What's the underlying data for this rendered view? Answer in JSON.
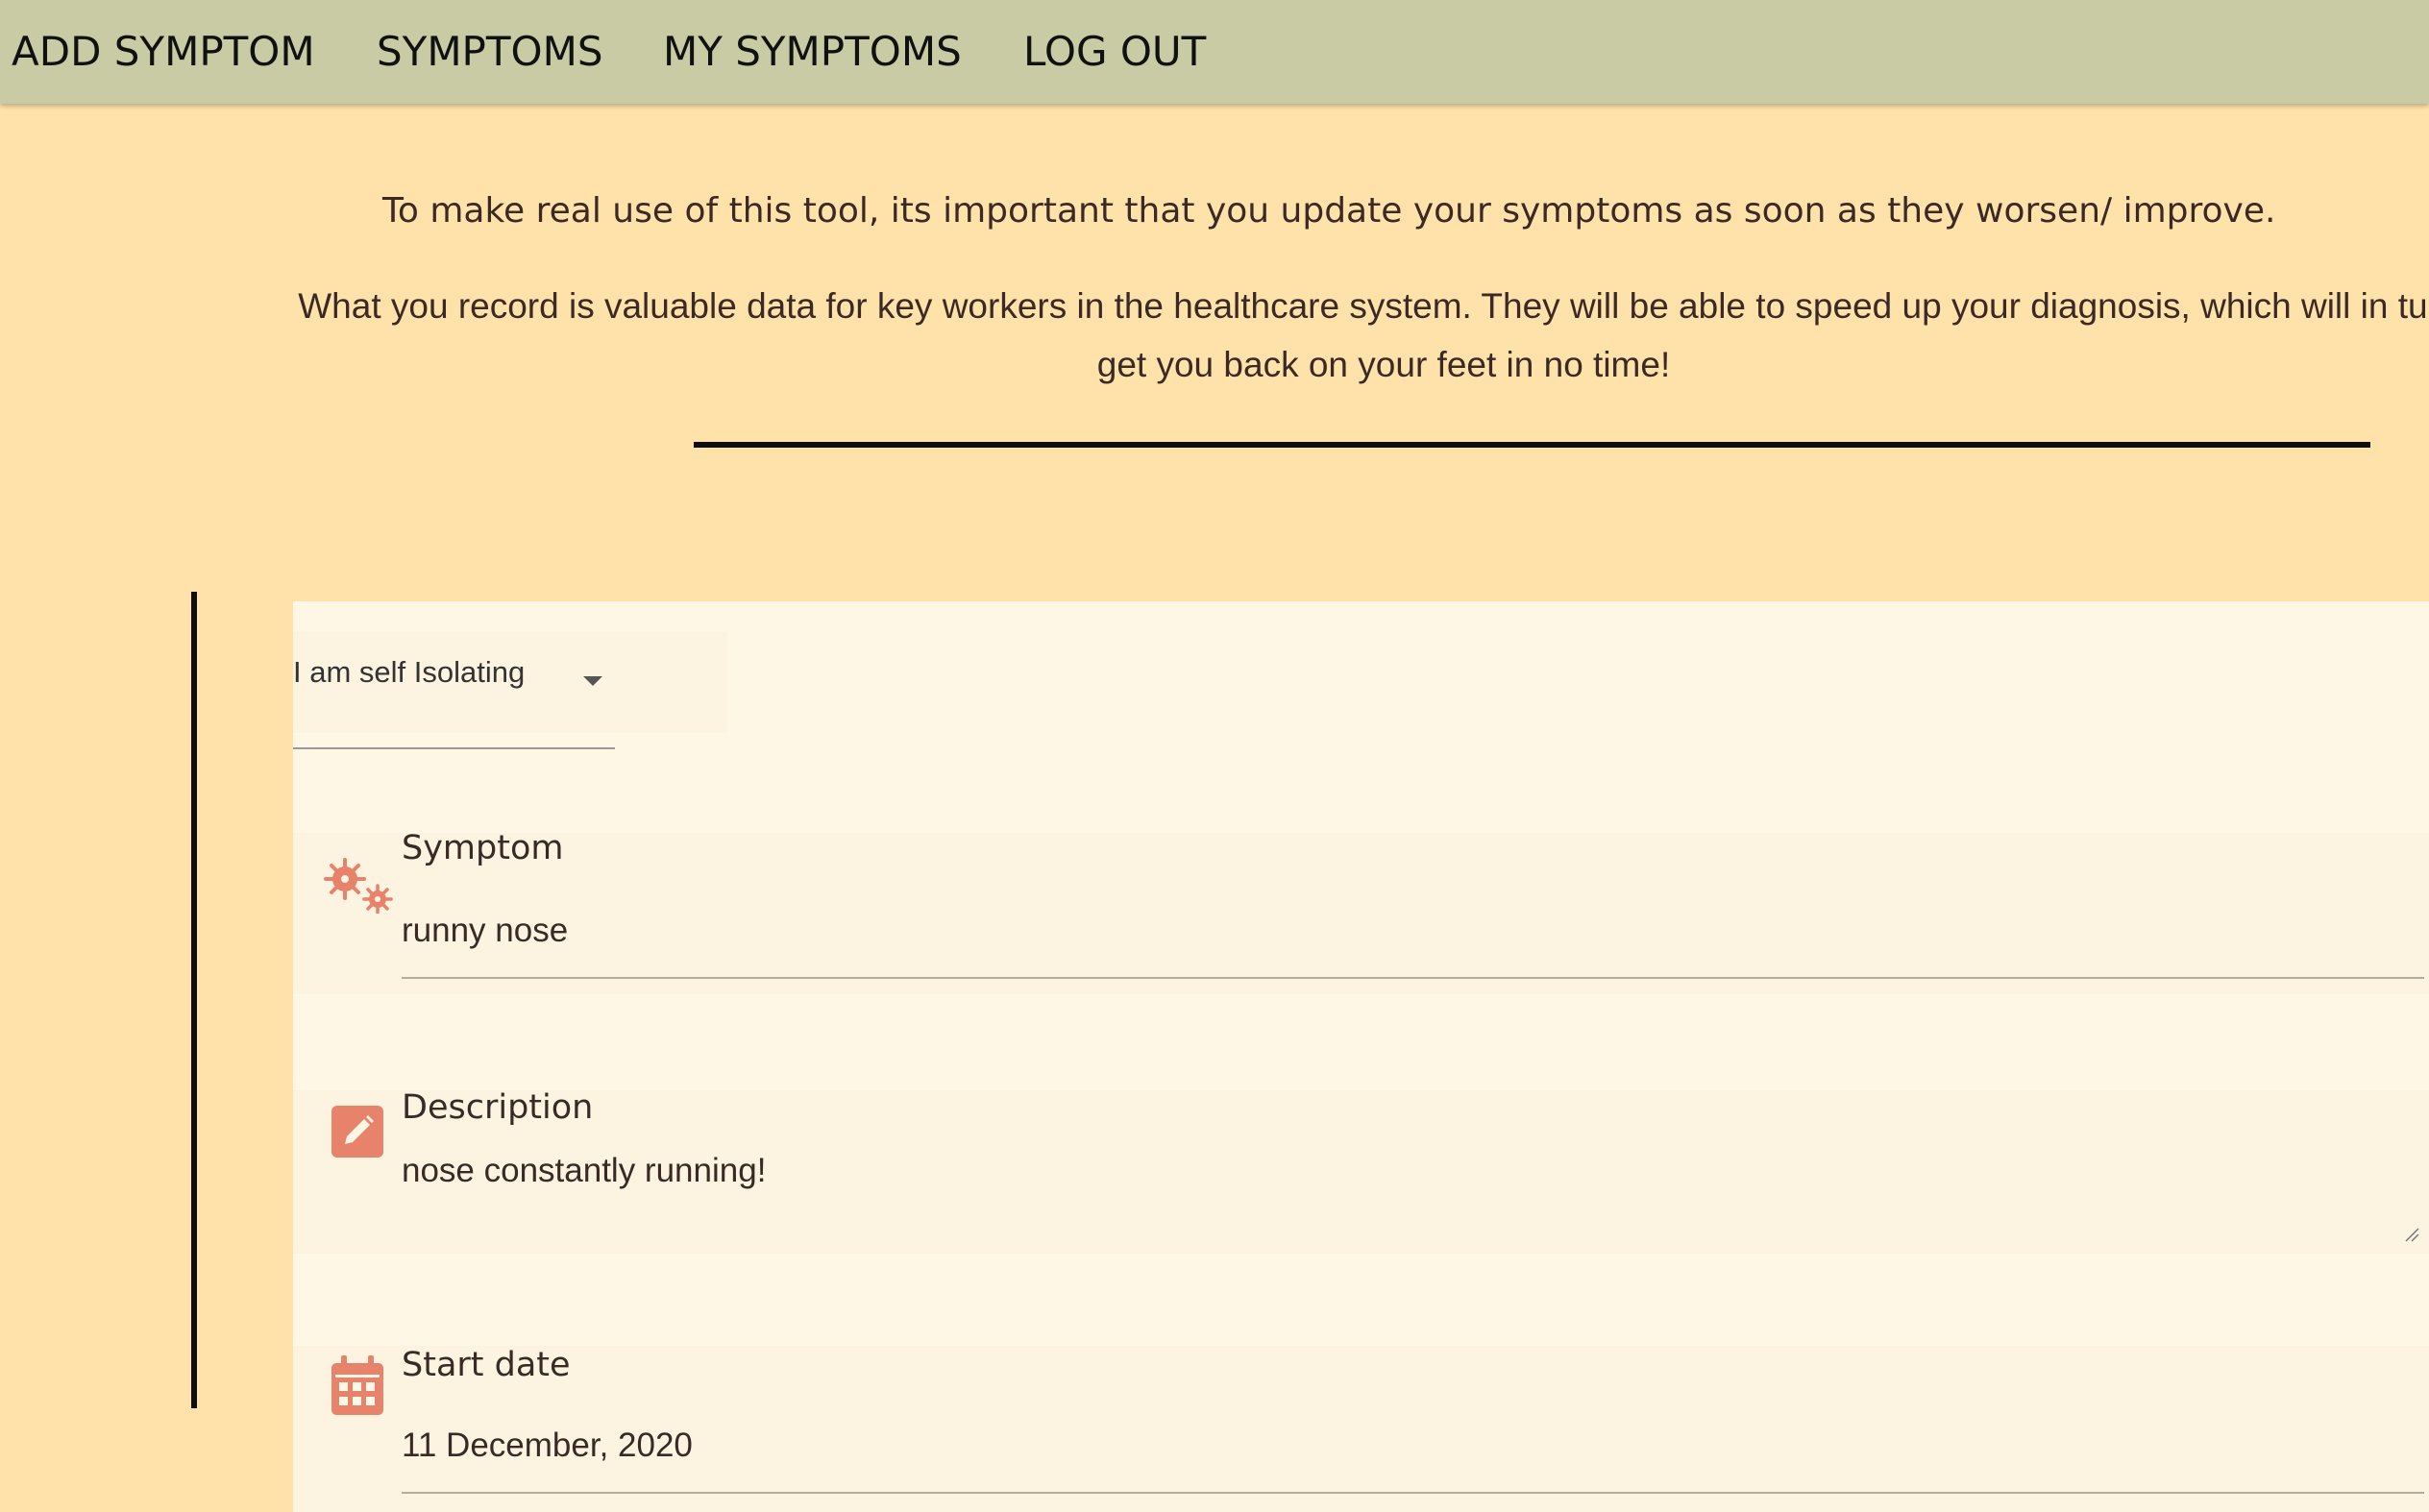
{
  "nav": {
    "items": [
      {
        "label": "ADD SYMPTOM"
      },
      {
        "label": "SYMPTOMS"
      },
      {
        "label": "MY SYMPTOMS"
      },
      {
        "label": "LOG OUT"
      }
    ]
  },
  "intro": {
    "line1": "To make real use of this tool, its important that you update your symptoms as soon as they worsen/ improve.",
    "line2": "What you record is valuable data for key workers in the healthcare system. They will be able to speed up your diagnosis, which will in turn, get you back on your feet in no time!"
  },
  "form": {
    "status_select": {
      "value": "I am self Isolating"
    },
    "symptom": {
      "label": "Symptom",
      "value": "runny nose",
      "icon": "virus-icon"
    },
    "description": {
      "label": "Description",
      "value": "nose constantly running!",
      "icon": "edit-icon"
    },
    "start_date": {
      "label": "Start date",
      "value": "11 December, 2020",
      "icon": "calendar-icon"
    }
  },
  "colors": {
    "nav_bg": "#c8cba4",
    "page_bg": "#ffe2aa",
    "card_bg": "#fff7e6",
    "icon_accent": "#e8836b"
  }
}
